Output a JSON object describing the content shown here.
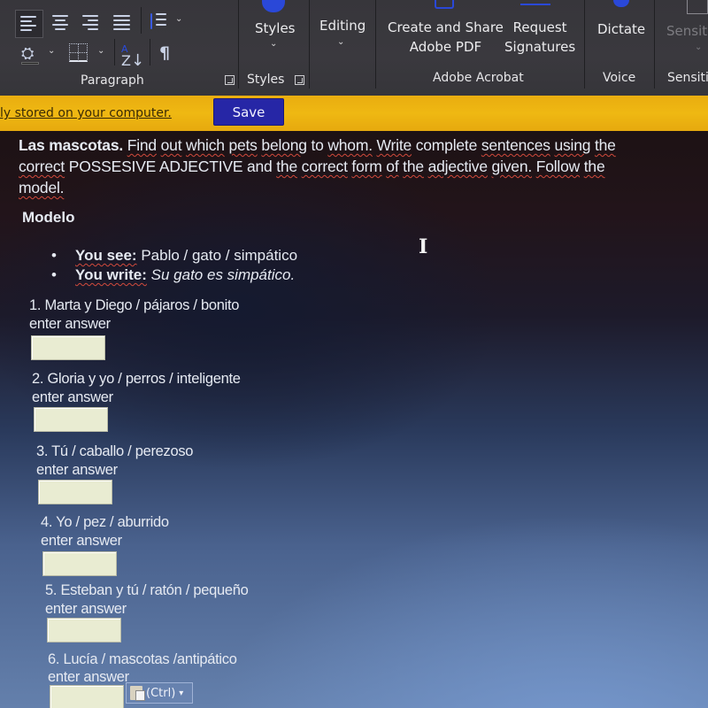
{
  "ribbon": {
    "groups": {
      "paragraph": "Paragraph",
      "styles": "Styles",
      "adobe_acrobat": "Adobe Acrobat",
      "voice": "Voice",
      "sensitivity": "Sensiti"
    },
    "buttons": {
      "styles": "Styles",
      "editing": "Editing",
      "create_share_pdf_line1": "Create and Share",
      "create_share_pdf_line2": "Adobe PDF",
      "request_signatures_line1": "Request",
      "request_signatures_line2": "Signatures",
      "dictate": "Dictate",
      "sensitivity": "Sensiti"
    },
    "icons": {
      "align_left": "align-left-icon",
      "align_center": "align-center-icon",
      "align_right": "align-right-icon",
      "justify": "justify-icon",
      "line_spacing": "line-spacing-icon",
      "shading": "shading-icon",
      "borders": "borders-icon",
      "sort": "sort-az-icon",
      "show_marks": "pilcrow-icon"
    }
  },
  "infobar": {
    "message": "ly stored on your computer.",
    "save_label": "Save",
    "color": "#efb812",
    "save_color": "#2626a6"
  },
  "document": {
    "title_bold": "Las mascotas.",
    "instructions_line1_rest": [
      {
        "text": "Find",
        "squiggle": true
      },
      {
        "text": "out",
        "squiggle": true
      },
      {
        "text": "which",
        "squiggle": true
      },
      {
        "text": "pets",
        "squiggle": true
      },
      {
        "text": "belong",
        "squiggle": true
      },
      {
        "text": "to",
        "squiggle": false
      },
      {
        "text": "whom.",
        "squiggle": true
      },
      {
        "text": "Write",
        "squiggle": true
      },
      {
        "text": "complete",
        "squiggle": false
      },
      {
        "text": "sentences",
        "squiggle": true
      },
      {
        "text": "using",
        "squiggle": true
      },
      {
        "text": "the",
        "squiggle": true
      }
    ],
    "instructions_line2": [
      {
        "text": "correct",
        "squiggle": true
      },
      {
        "text": "POSSESIVE ADJECTIVE and",
        "squiggle": false
      },
      {
        "text": "the",
        "squiggle": true
      },
      {
        "text": "correct",
        "squiggle": true
      },
      {
        "text": "form",
        "squiggle": true
      },
      {
        "text": "of",
        "squiggle": true
      },
      {
        "text": "the",
        "squiggle": true
      },
      {
        "text": "adjective",
        "squiggle": true
      },
      {
        "text": "given.",
        "squiggle": true
      },
      {
        "text": "Follow",
        "squiggle": true
      },
      {
        "text": "the",
        "squiggle": true
      }
    ],
    "instructions_line3": "model.",
    "modelo_label": "Modelo",
    "example": {
      "see_label": "You see:",
      "see_value": "Pablo / gato / simpático",
      "write_label": "You write:",
      "write_value": "Su gato es simpático."
    },
    "answer_placeholder": "enter answer",
    "questions": [
      {
        "label": "1. Marta y Diego / pájaros / bonito",
        "value": ""
      },
      {
        "label": "2. Gloria y yo / perros / inteligente",
        "value": ""
      },
      {
        "label": "3. Tú / caballo / perezoso",
        "value": ""
      },
      {
        "label": "4. Yo / pez / aburrido",
        "value": ""
      },
      {
        "label": "5. Esteban y tú / ratón / pequeño",
        "value": ""
      },
      {
        "label": "6. Lucía / mascotas /antipático",
        "value": ""
      }
    ],
    "paste_options_label": "(Ctrl)",
    "paste_options_chevron": "▾"
  }
}
